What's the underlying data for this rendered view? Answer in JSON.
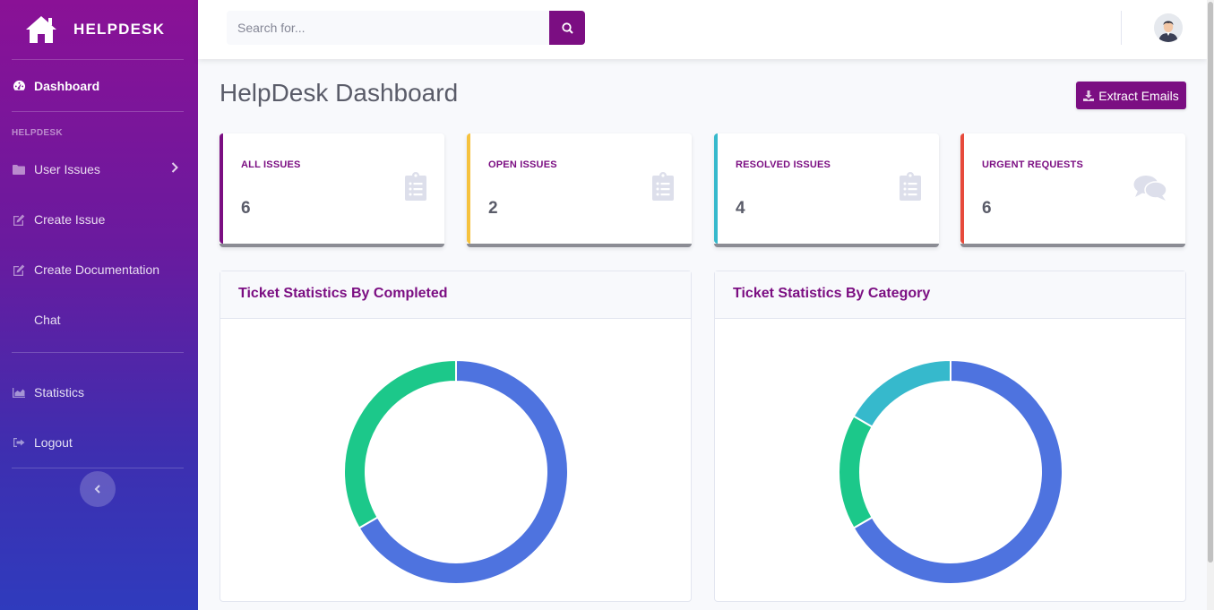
{
  "brand": {
    "name": "HELPDESK"
  },
  "sidebar": {
    "dashboard": "Dashboard",
    "heading": "HELPDESK",
    "items": [
      {
        "label": "User Issues",
        "icon": "folder-icon"
      },
      {
        "label": "Create Issue",
        "icon": "edit-icon"
      },
      {
        "label": "Create Documentation",
        "icon": "edit-icon"
      },
      {
        "label": "Chat",
        "icon": ""
      }
    ],
    "items2": [
      {
        "label": "Statistics",
        "icon": "area-chart-icon"
      },
      {
        "label": "Logout",
        "icon": "sign-out-icon"
      }
    ]
  },
  "topbar": {
    "search_placeholder": "Search for..."
  },
  "page": {
    "title": "HelpDesk Dashboard",
    "extract_label": "Extract Emails"
  },
  "cards": [
    {
      "label": "ALL ISSUES",
      "value": "6",
      "accent": "#7b0e82",
      "icon": "clipboard-list-icon"
    },
    {
      "label": "OPEN ISSUES",
      "value": "2",
      "accent": "#f6c23e",
      "icon": "clipboard-list-icon"
    },
    {
      "label": "RESOLVED ISSUES",
      "value": "4",
      "accent": "#36b9cc",
      "icon": "clipboard-list-icon"
    },
    {
      "label": "URGENT REQUESTS",
      "value": "6",
      "accent": "#e74a3b",
      "icon": "comments-icon"
    }
  ],
  "panels": [
    {
      "title": "Ticket Statistics By Completed"
    },
    {
      "title": "Ticket Statistics By Category"
    }
  ],
  "chart_data": [
    {
      "type": "pie",
      "title": "Ticket Statistics By Completed",
      "series": [
        {
          "values": [
            4,
            2
          ]
        }
      ],
      "colors": [
        "#4e73df",
        "#1cc88a"
      ]
    },
    {
      "type": "pie",
      "title": "Ticket Statistics By Category",
      "series": [
        {
          "values": [
            4,
            1,
            1
          ]
        }
      ],
      "colors": [
        "#4e73df",
        "#1cc88a",
        "#36b9cc"
      ]
    }
  ]
}
